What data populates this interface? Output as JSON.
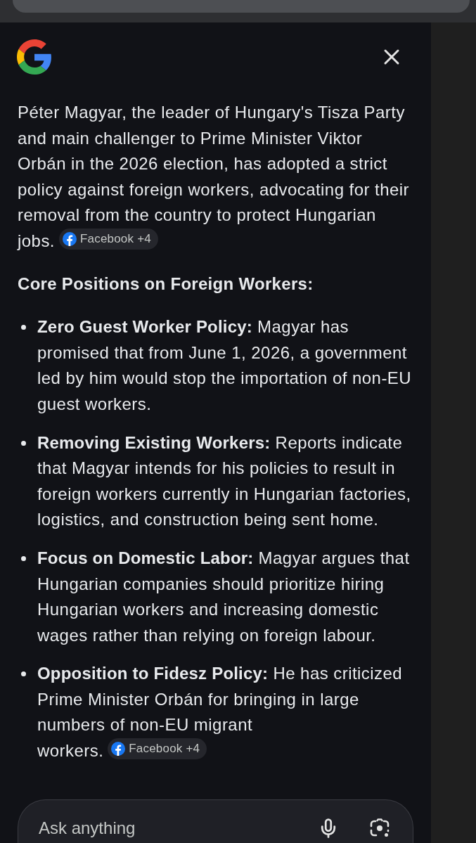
{
  "answer": {
    "intro": "Péter Magyar, the leader of Hungary's Tisza Party and main challenger to Prime Minister Viktor Orbán in the 2026 election, has adopted a strict policy against foreign workers, advocating for their removal from the country to protect Hungarian jobs.",
    "intro_source": "Facebook +4",
    "heading": "Core Positions on Foreign Workers:",
    "points": [
      {
        "text": "**Zero Guest Worker Policy:** Magyar has promised that from June 1, 2026, a government led by him would stop the importation of non-EU guest workers."
      },
      {
        "text": "**Removing Existing Workers:** Reports indicate that Magyar intends for his policies to result in foreign workers currently in Hungarian factories, logistics, and construction being sent home."
      },
      {
        "text": "**Focus on Domestic Labor:** Magyar argues that Hungarian companies should prioritize hiring Hungarian workers and increasing domestic wages rather than relying on foreign labour."
      },
      {
        "text": "**Opposition to Fidesz Policy:** He has criticized Prime Minister Orbán for bringing in large numbers of non-EU migrant workers.",
        "source": "Facebook +4"
      }
    ]
  },
  "input": {
    "placeholder": "Ask anything"
  }
}
